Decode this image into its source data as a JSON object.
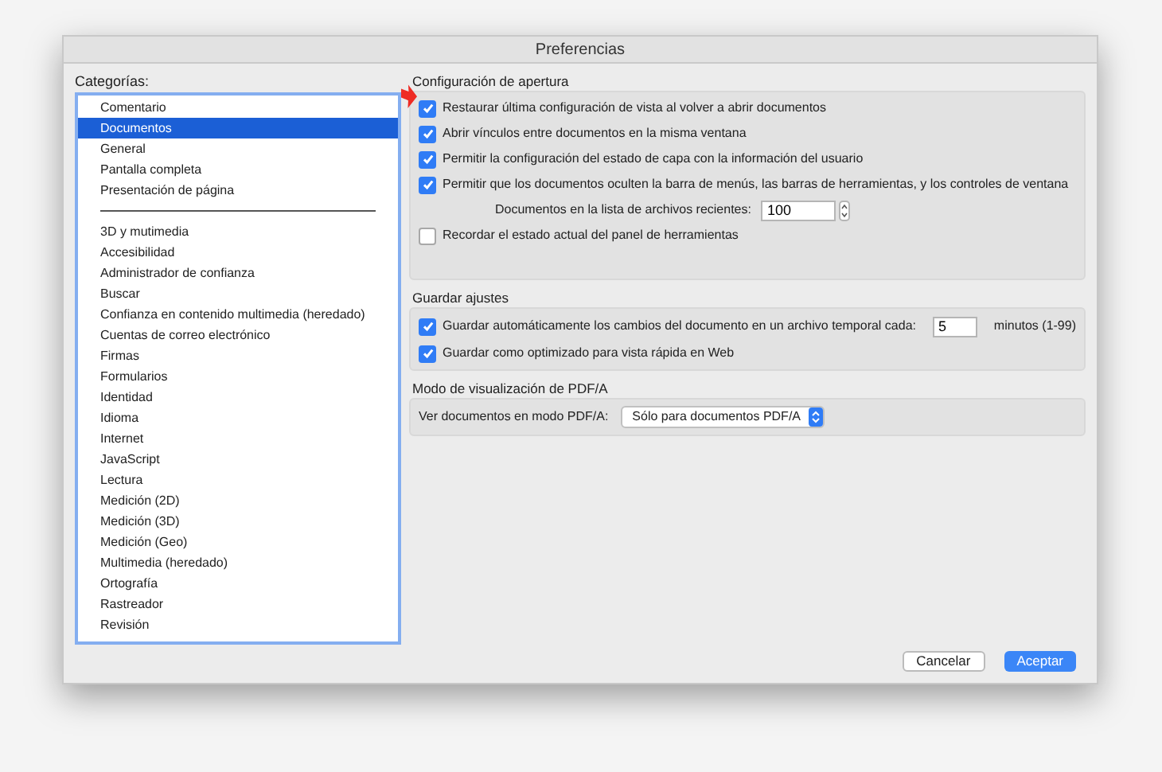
{
  "window": {
    "title": "Preferencias"
  },
  "categories": {
    "label": "Categorías:",
    "groups": [
      [
        {
          "label": "Comentario",
          "selected": false
        },
        {
          "label": "Documentos",
          "selected": true
        },
        {
          "label": "General",
          "selected": false
        },
        {
          "label": "Pantalla completa",
          "selected": false
        },
        {
          "label": "Presentación de página",
          "selected": false
        }
      ],
      [
        {
          "label": "3D y mutimedia",
          "selected": false
        },
        {
          "label": "Accesibilidad",
          "selected": false
        },
        {
          "label": "Administrador de confianza",
          "selected": false
        },
        {
          "label": "Buscar",
          "selected": false
        },
        {
          "label": "Confianza en contenido multimedia (heredado)",
          "selected": false
        },
        {
          "label": "Cuentas de correo electrónico",
          "selected": false
        },
        {
          "label": "Firmas",
          "selected": false
        },
        {
          "label": "Formularios",
          "selected": false
        },
        {
          "label": "Identidad",
          "selected": false
        },
        {
          "label": "Idioma",
          "selected": false
        },
        {
          "label": "Internet",
          "selected": false
        },
        {
          "label": "JavaScript",
          "selected": false
        },
        {
          "label": "Lectura",
          "selected": false
        },
        {
          "label": "Medición (2D)",
          "selected": false
        },
        {
          "label": "Medición (3D)",
          "selected": false
        },
        {
          "label": "Medición (Geo)",
          "selected": false
        },
        {
          "label": "Multimedia (heredado)",
          "selected": false
        },
        {
          "label": "Ortografía",
          "selected": false
        },
        {
          "label": "Rastreador",
          "selected": false
        },
        {
          "label": "Revisión",
          "selected": false
        }
      ]
    ]
  },
  "sections": [
    {
      "title": "Configuración de apertura",
      "items": [
        {
          "kind": "checkbox",
          "label": "Restaurar última configuración de vista al volver a abrir documentos",
          "checked": true
        },
        {
          "kind": "checkbox",
          "label": "Abrir vínculos entre documentos en la misma ventana",
          "checked": true
        },
        {
          "kind": "checkbox",
          "label": "Permitir la configuración del estado de capa con la información del usuario",
          "checked": true
        },
        {
          "kind": "checkbox",
          "label": "Permitir que los documentos oculten la barra de menús, las barras de herramientas, y los controles de ventana",
          "checked": true
        },
        {
          "kind": "stepper",
          "label": "Documentos en la lista de archivos recientes:",
          "value": "100"
        },
        {
          "kind": "checkbox",
          "label": "Recordar el estado actual del panel de herramientas",
          "checked": false
        }
      ]
    },
    {
      "title": "Guardar ajustes",
      "items": [
        {
          "kind": "checkbox_input",
          "label": "Guardar automáticamente los cambios del documento en un archivo temporal cada:",
          "checked": true,
          "value": "5",
          "suffix": "minutos (1-99)"
        },
        {
          "kind": "checkbox",
          "label": "Guardar como optimizado para vista rápida en Web",
          "checked": true
        }
      ]
    },
    {
      "title": "Modo de visualización de PDF/A",
      "items": [
        {
          "kind": "select",
          "label": "Ver documentos en modo PDF/A:",
          "value": "Sólo para documentos PDF/A"
        }
      ]
    }
  ],
  "buttons": [
    {
      "label": "Cancelar",
      "kind": "secondary"
    },
    {
      "label": "Aceptar",
      "kind": "primary"
    }
  ]
}
